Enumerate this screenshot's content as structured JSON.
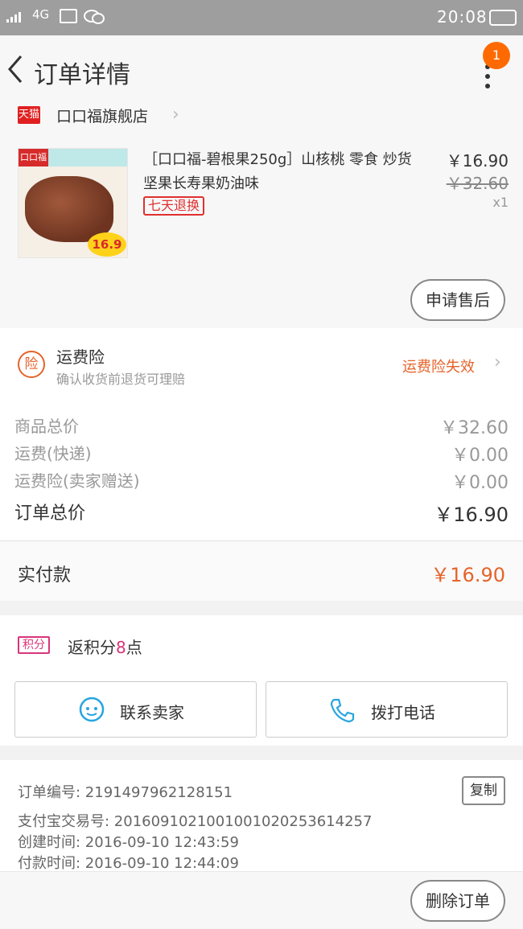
{
  "status_bar": {
    "network": "4G",
    "time": "20:08"
  },
  "nav": {
    "title": "订单详情",
    "badge_count": "1"
  },
  "shop": {
    "name": "口口福旗舰店",
    "platform_badge": "天猫"
  },
  "product": {
    "title": "［口口福-碧根果250g］山核桃 零食 炒货坚果长寿果奶油味",
    "refund_tag": "七天退换",
    "price": "￥16.90",
    "original_price": "￥32.60",
    "quantity": "x1",
    "thumb_brand": "口口福",
    "thumb_price": "16.9",
    "after_sale_label": "申请售后"
  },
  "insurance": {
    "icon_text": "险",
    "title": "运费险",
    "subtitle": "确认收货前退货可理赔",
    "status": "运费险失效"
  },
  "costs": [
    {
      "label": "商品总价",
      "value": "￥32.60"
    },
    {
      "label": "运费(快递)",
      "value": "￥0.00"
    },
    {
      "label": "运费险(卖家赠送)",
      "value": "￥0.00"
    },
    {
      "label": "订单总价",
      "value": "￥16.90"
    }
  ],
  "paid": {
    "label": "实付款",
    "value": "￥16.90"
  },
  "points": {
    "badge": "积分",
    "prefix": "返积分",
    "amount": "8",
    "suffix": "点"
  },
  "actions": {
    "contact_seller": "联系卖家",
    "call_phone": "拨打电话"
  },
  "order_info": {
    "order_no": "订单编号: 2191497962128151",
    "alipay_no": "支付宝交易号: 2016091021001001020253614257",
    "created": "创建时间: 2016-09-10 12:43:59",
    "paid_time": "付款时间: 2016-09-10 12:44:09",
    "copy_label": "复制"
  },
  "bottom": {
    "delete_label": "删除订单"
  },
  "colors": {
    "accent": "#e6632a",
    "points": "#d8357a",
    "refund": "#e03030"
  }
}
